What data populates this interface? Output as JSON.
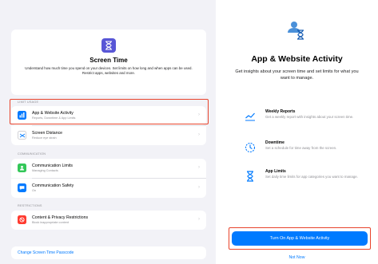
{
  "left_panel": {
    "hero": {
      "title": "Screen Time",
      "description": "Understand how much time you spend on your devices. Set limits on how long and when apps can be used. Restrict apps, websites and more."
    },
    "sections": [
      {
        "label": "LIMIT USAGE",
        "items": [
          {
            "title": "App & Website Activity",
            "subtitle": "Reports, Downtime & App Limits",
            "icon": "chart-icon",
            "color": "#007aff"
          },
          {
            "title": "Screen Distance",
            "subtitle": "Reduce eye strain",
            "icon": "distance-icon",
            "color": "#ffffff"
          }
        ]
      },
      {
        "label": "COMMUNICATION",
        "items": [
          {
            "title": "Communication Limits",
            "subtitle": "Managing Contacts",
            "icon": "person-bubble-icon",
            "color": "#34c759"
          },
          {
            "title": "Communication Safety",
            "subtitle": "On",
            "icon": "bubble-icon",
            "color": "#007aff"
          }
        ]
      },
      {
        "label": "RESTRICTIONS",
        "items": [
          {
            "title": "Content & Privacy Restrictions",
            "subtitle": "Block inappropriate content",
            "icon": "no-entry-icon",
            "color": "#ff3b30"
          }
        ]
      }
    ],
    "passcode_link": "Change Screen Time Passcode"
  },
  "right_panel": {
    "title": "App & Website Activity",
    "subtitle": "Get insights about your screen time and set limits for what you want to manage.",
    "features": [
      {
        "title": "Weekly Reports",
        "description": "Get a weekly report with insights about your screen time.",
        "icon": "trend-chart-icon"
      },
      {
        "title": "Downtime",
        "description": "Set a schedule for time away from the screen.",
        "icon": "moon-clock-icon"
      },
      {
        "title": "App Limits",
        "description": "Set daily time limits for app categories you want to manage.",
        "icon": "hourglass-icon"
      }
    ],
    "primary_button": "Turn On App & Website Activity",
    "secondary_button": "Not Now"
  },
  "colors": {
    "accent": "#007aff",
    "highlight": "#e8442c",
    "screen_time": "#5856d6"
  }
}
